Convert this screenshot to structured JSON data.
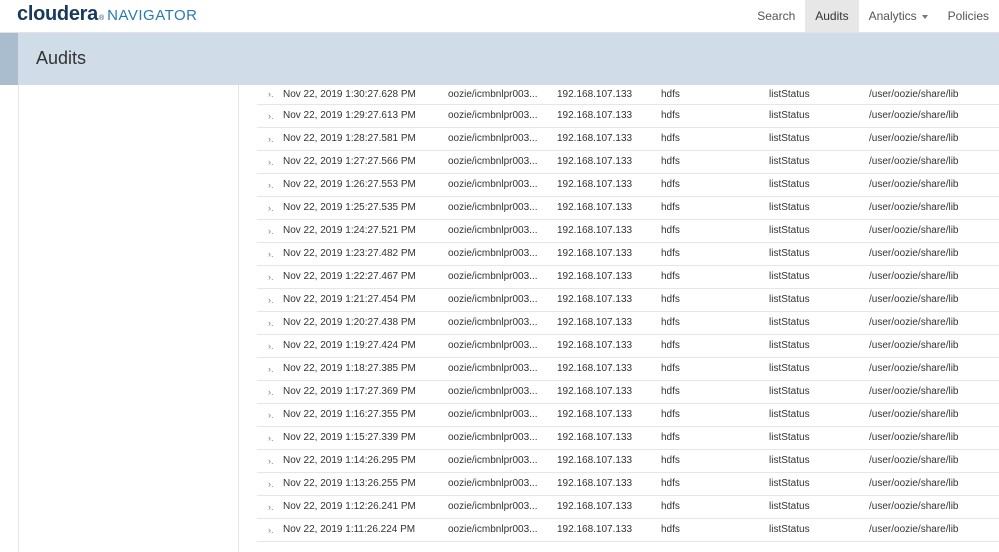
{
  "brand": {
    "name": "cloudera",
    "mark": "®",
    "product": "NAVIGATOR",
    "colors": {
      "cloudera": "#1a3a5c",
      "navigator": "#2a7ab0"
    }
  },
  "nav": {
    "items": [
      {
        "label": "Search",
        "active": false
      },
      {
        "label": "Audits",
        "active": true
      },
      {
        "label": "Analytics",
        "active": false,
        "dropdown": true
      },
      {
        "label": "Policies",
        "active": false
      }
    ]
  },
  "header": {
    "title": "Audits",
    "background": "#d0dde8"
  },
  "audits": {
    "rows": [
      {
        "time": "Nov 22, 2019 1:30:27.628 PM",
        "user": "oozie/icmbnlpr003...",
        "ip": "192.168.107.133",
        "service": "hdfs",
        "operation": "listStatus",
        "resource": "/user/oozie/share/lib"
      },
      {
        "time": "Nov 22, 2019 1:29:27.613 PM",
        "user": "oozie/icmbnlpr003...",
        "ip": "192.168.107.133",
        "service": "hdfs",
        "operation": "listStatus",
        "resource": "/user/oozie/share/lib"
      },
      {
        "time": "Nov 22, 2019 1:28:27.581 PM",
        "user": "oozie/icmbnlpr003...",
        "ip": "192.168.107.133",
        "service": "hdfs",
        "operation": "listStatus",
        "resource": "/user/oozie/share/lib"
      },
      {
        "time": "Nov 22, 2019 1:27:27.566 PM",
        "user": "oozie/icmbnlpr003...",
        "ip": "192.168.107.133",
        "service": "hdfs",
        "operation": "listStatus",
        "resource": "/user/oozie/share/lib"
      },
      {
        "time": "Nov 22, 2019 1:26:27.553 PM",
        "user": "oozie/icmbnlpr003...",
        "ip": "192.168.107.133",
        "service": "hdfs",
        "operation": "listStatus",
        "resource": "/user/oozie/share/lib"
      },
      {
        "time": "Nov 22, 2019 1:25:27.535 PM",
        "user": "oozie/icmbnlpr003...",
        "ip": "192.168.107.133",
        "service": "hdfs",
        "operation": "listStatus",
        "resource": "/user/oozie/share/lib"
      },
      {
        "time": "Nov 22, 2019 1:24:27.521 PM",
        "user": "oozie/icmbnlpr003...",
        "ip": "192.168.107.133",
        "service": "hdfs",
        "operation": "listStatus",
        "resource": "/user/oozie/share/lib"
      },
      {
        "time": "Nov 22, 2019 1:23:27.482 PM",
        "user": "oozie/icmbnlpr003...",
        "ip": "192.168.107.133",
        "service": "hdfs",
        "operation": "listStatus",
        "resource": "/user/oozie/share/lib"
      },
      {
        "time": "Nov 22, 2019 1:22:27.467 PM",
        "user": "oozie/icmbnlpr003...",
        "ip": "192.168.107.133",
        "service": "hdfs",
        "operation": "listStatus",
        "resource": "/user/oozie/share/lib"
      },
      {
        "time": "Nov 22, 2019 1:21:27.454 PM",
        "user": "oozie/icmbnlpr003...",
        "ip": "192.168.107.133",
        "service": "hdfs",
        "operation": "listStatus",
        "resource": "/user/oozie/share/lib"
      },
      {
        "time": "Nov 22, 2019 1:20:27.438 PM",
        "user": "oozie/icmbnlpr003...",
        "ip": "192.168.107.133",
        "service": "hdfs",
        "operation": "listStatus",
        "resource": "/user/oozie/share/lib"
      },
      {
        "time": "Nov 22, 2019 1:19:27.424 PM",
        "user": "oozie/icmbnlpr003...",
        "ip": "192.168.107.133",
        "service": "hdfs",
        "operation": "listStatus",
        "resource": "/user/oozie/share/lib"
      },
      {
        "time": "Nov 22, 2019 1:18:27.385 PM",
        "user": "oozie/icmbnlpr003...",
        "ip": "192.168.107.133",
        "service": "hdfs",
        "operation": "listStatus",
        "resource": "/user/oozie/share/lib"
      },
      {
        "time": "Nov 22, 2019 1:17:27.369 PM",
        "user": "oozie/icmbnlpr003...",
        "ip": "192.168.107.133",
        "service": "hdfs",
        "operation": "listStatus",
        "resource": "/user/oozie/share/lib"
      },
      {
        "time": "Nov 22, 2019 1:16:27.355 PM",
        "user": "oozie/icmbnlpr003...",
        "ip": "192.168.107.133",
        "service": "hdfs",
        "operation": "listStatus",
        "resource": "/user/oozie/share/lib"
      },
      {
        "time": "Nov 22, 2019 1:15:27.339 PM",
        "user": "oozie/icmbnlpr003...",
        "ip": "192.168.107.133",
        "service": "hdfs",
        "operation": "listStatus",
        "resource": "/user/oozie/share/lib"
      },
      {
        "time": "Nov 22, 2019 1:14:26.295 PM",
        "user": "oozie/icmbnlpr003...",
        "ip": "192.168.107.133",
        "service": "hdfs",
        "operation": "listStatus",
        "resource": "/user/oozie/share/lib"
      },
      {
        "time": "Nov 22, 2019 1:13:26.255 PM",
        "user": "oozie/icmbnlpr003...",
        "ip": "192.168.107.133",
        "service": "hdfs",
        "operation": "listStatus",
        "resource": "/user/oozie/share/lib"
      },
      {
        "time": "Nov 22, 2019 1:12:26.241 PM",
        "user": "oozie/icmbnlpr003...",
        "ip": "192.168.107.133",
        "service": "hdfs",
        "operation": "listStatus",
        "resource": "/user/oozie/share/lib"
      },
      {
        "time": "Nov 22, 2019 1:11:26.224 PM",
        "user": "oozie/icmbnlpr003...",
        "ip": "192.168.107.133",
        "service": "hdfs",
        "operation": "listStatus",
        "resource": "/user/oozie/share/lib"
      }
    ],
    "expand_icon": "chevron-right-icon"
  }
}
